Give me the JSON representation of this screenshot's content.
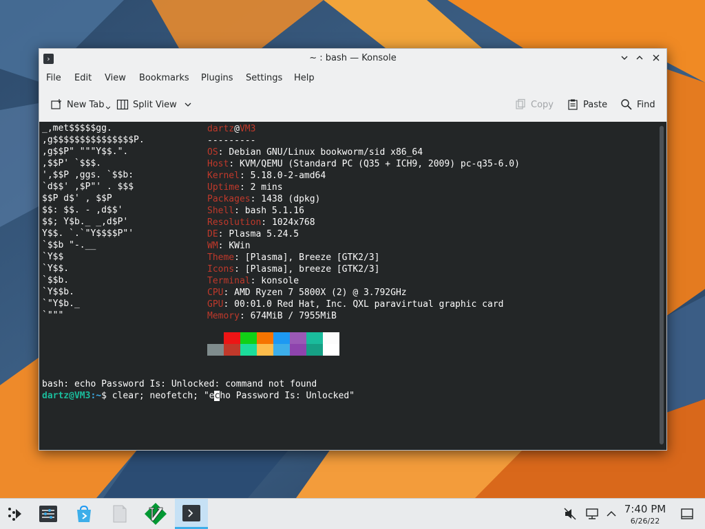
{
  "window": {
    "title": "~ : bash — Konsole",
    "menu": [
      "File",
      "Edit",
      "View",
      "Bookmarks",
      "Plugins",
      "Settings",
      "Help"
    ],
    "toolbar": {
      "new_tab": "New Tab",
      "split_view": "Split View",
      "copy": "Copy",
      "paste": "Paste",
      "find": "Find"
    }
  },
  "terminal": {
    "user": "dartz",
    "host": "VM3",
    "separator": "---------",
    "info": [
      {
        "key": "OS",
        "value": "Debian GNU/Linux bookworm/sid x86_64"
      },
      {
        "key": "Host",
        "value": "KVM/QEMU (Standard PC (Q35 + ICH9, 2009) pc-q35-6.0)"
      },
      {
        "key": "Kernel",
        "value": "5.18.0-2-amd64"
      },
      {
        "key": "Uptime",
        "value": "2 mins"
      },
      {
        "key": "Packages",
        "value": "1438 (dpkg)"
      },
      {
        "key": "Shell",
        "value": "bash 5.1.16"
      },
      {
        "key": "Resolution",
        "value": "1024x768"
      },
      {
        "key": "DE",
        "value": "Plasma 5.24.5"
      },
      {
        "key": "WM",
        "value": "KWin"
      },
      {
        "key": "Theme",
        "value": "[Plasma], Breeze [GTK2/3]"
      },
      {
        "key": "Icons",
        "value": "[Plasma], breeze [GTK2/3]"
      },
      {
        "key": "Terminal",
        "value": "konsole"
      },
      {
        "key": "CPU",
        "value": "AMD Ryzen 7 5800X (2) @ 3.792GHz"
      },
      {
        "key": "GPU",
        "value": "00:01.0 Red Hat, Inc. QXL paravirtual graphic card"
      },
      {
        "key": "Memory",
        "value": "674MiB / 7955MiB"
      }
    ],
    "logo_lines": [
      "       _,met$$$$$gg.",
      "    ,g$$$$$$$$$$$$$$$P.",
      "  ,g$$P\"     \"\"\"Y$$.\".",
      " ,$$P'              `$$$.",
      "',$$P       ,ggs.     `$$b:",
      "`d$$'     ,$P\"'   .    $$$",
      " $$P      d$'     ,    $$P",
      " $$:      $$.   -    ,d$$'",
      " $$;      Y$b._   _,d$P'",
      " Y$$.    `.`\"Y$$$$P\"'",
      " `$$b      \"-.__",
      "  `Y$$",
      "   `Y$$.",
      "     `$$b.",
      "       `Y$$b.",
      "          `\"Y$b._",
      "              `\"\"\""
    ],
    "colors_top": [
      "#232627",
      "#ed1515",
      "#11d116",
      "#f67400",
      "#1d99f3",
      "#9b59b6",
      "#1abc9c",
      "#fcfcfc"
    ],
    "colors_bottom": [
      "#7f8c8d",
      "#c0392b",
      "#1cdc9a",
      "#fdbc4b",
      "#3daee9",
      "#8e44ad",
      "#16a085",
      "#ffffff"
    ],
    "error_line": "bash: echo Password Is: Unlocked: command not found",
    "prompt_user": "dartz@VM3",
    "prompt_path": ":~",
    "prompt_symbol": "$ ",
    "cmd_before_cursor": "clear; neofetch; \"e",
    "cmd_cursor": "c",
    "cmd_after_cursor": "ho Password Is: Unlocked\""
  },
  "taskbar": {
    "time": "7:40 PM",
    "date": "6/26/22",
    "apps": [
      "application-launcher-icon",
      "system-settings-icon",
      "discover-icon",
      "file-manager-icon",
      "vim-icon",
      "konsole-icon"
    ]
  }
}
